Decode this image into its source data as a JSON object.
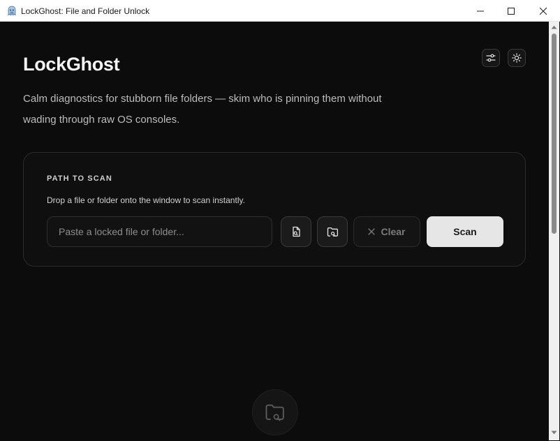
{
  "window": {
    "title": "LockGhost: File and Folder Unlock"
  },
  "header": {
    "title": "LockGhost",
    "subtitle": "Calm diagnostics for stubborn file folders — skim who is pinning them without wading through raw OS consoles.",
    "settings_icon": "sliders-icon",
    "theme_icon": "sun-icon"
  },
  "scan_panel": {
    "label": "PATH TO SCAN",
    "hint": "Drop a file or folder onto the window to scan instantly.",
    "input_placeholder": "Paste a locked file or folder...",
    "input_value": "",
    "browse_file_icon": "file-search-icon",
    "browse_folder_icon": "folder-search-icon",
    "clear_label": "Clear",
    "scan_label": "Scan"
  },
  "empty_state": {
    "icon": "folder-search-icon"
  },
  "colors": {
    "background": "#0c0c0d",
    "panel_border": "#2c2c2e",
    "scan_button": "#e6e6e6",
    "text_primary": "#f4f4f4",
    "text_secondary": "#bdbdbd"
  }
}
